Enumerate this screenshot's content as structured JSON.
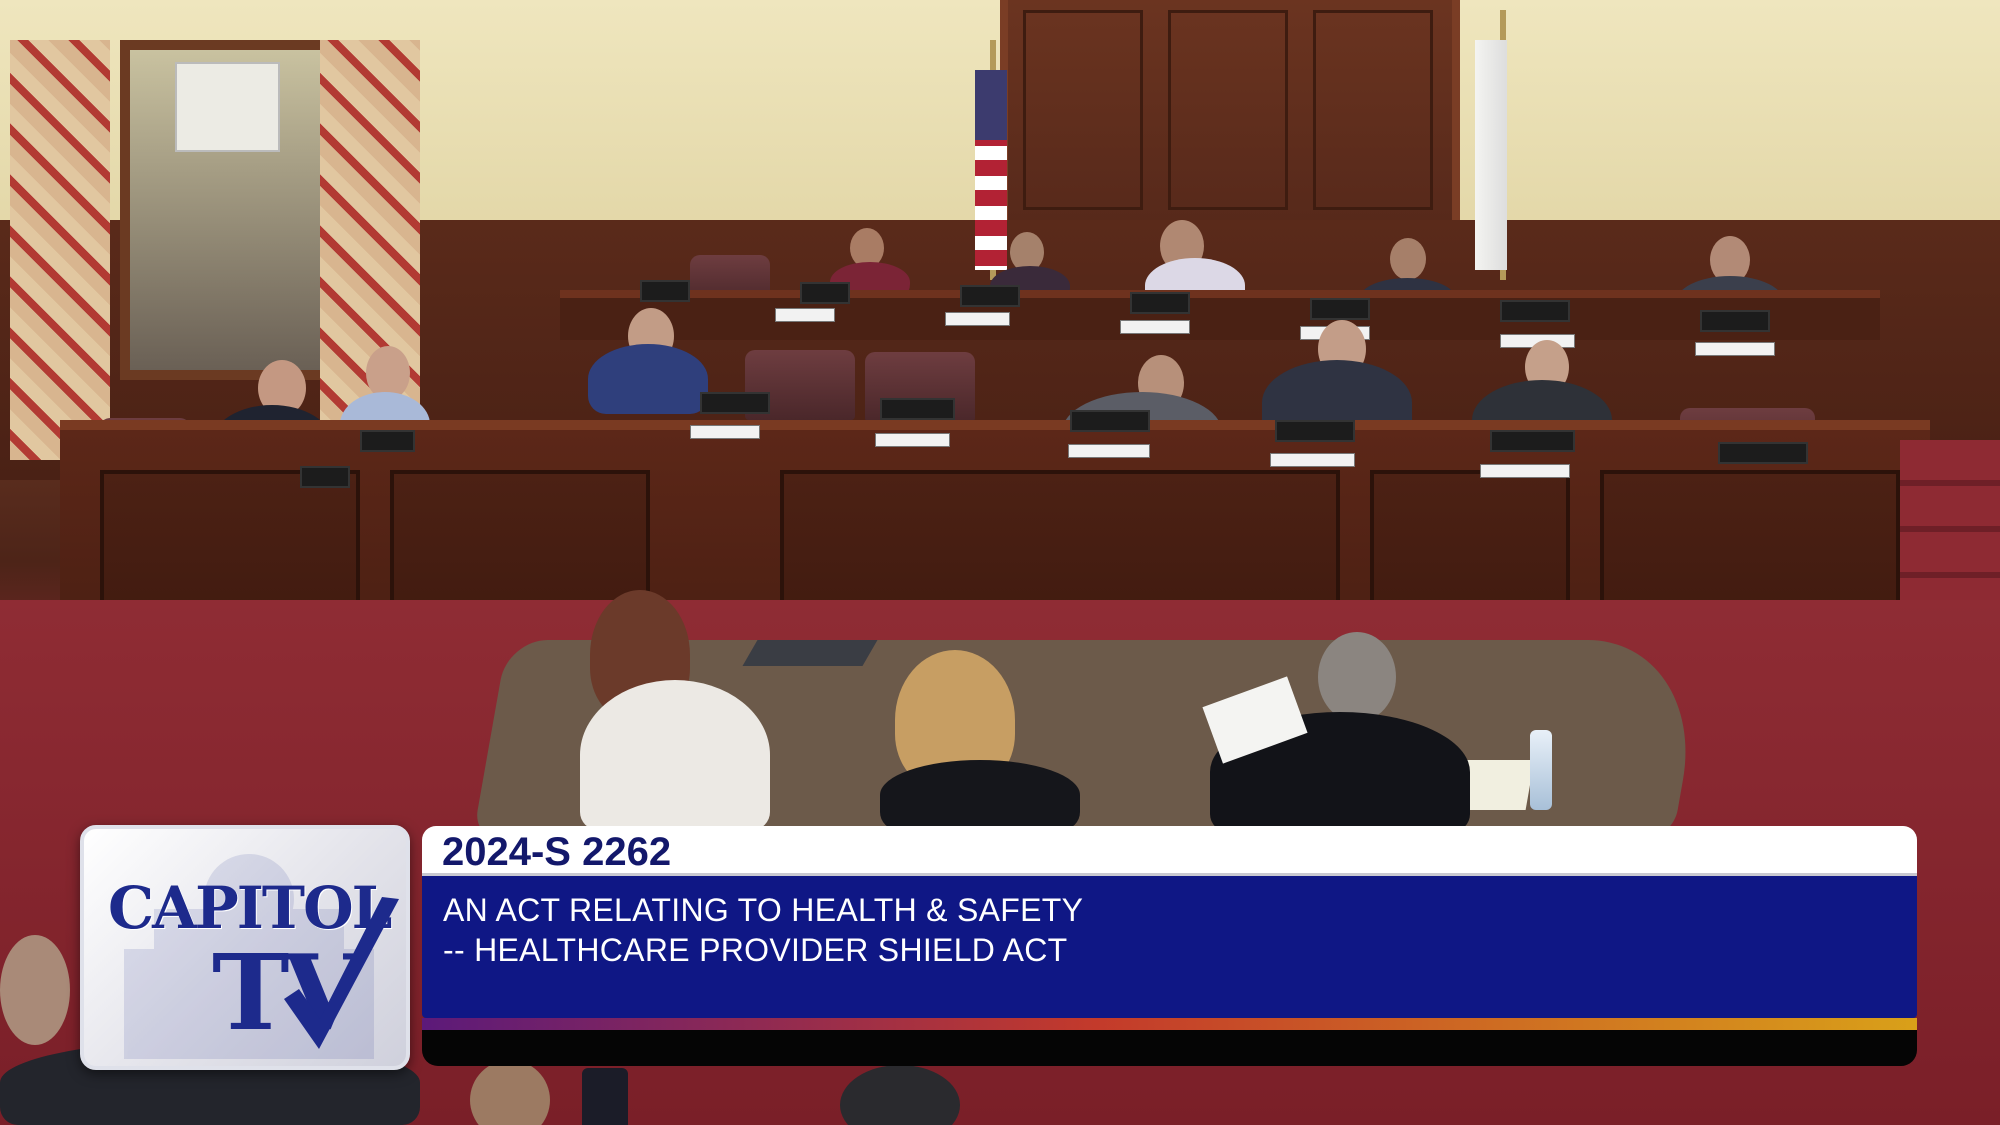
{
  "broadcast": {
    "logo_line1": "CAPITOL",
    "logo_line2": "TV",
    "bill_number": "2024-S 2262",
    "title_line1": "AN ACT RELATING TO HEALTH & SAFETY",
    "title_line2": "-- HEALTHCARE PROVIDER SHIELD ACT"
  },
  "colors": {
    "logo_blue": "#1d2a8c",
    "description_bar": "#0f1785",
    "bill_bar": "#ffffff",
    "carpet": "#8a2a32",
    "wood": "#4d2418"
  }
}
